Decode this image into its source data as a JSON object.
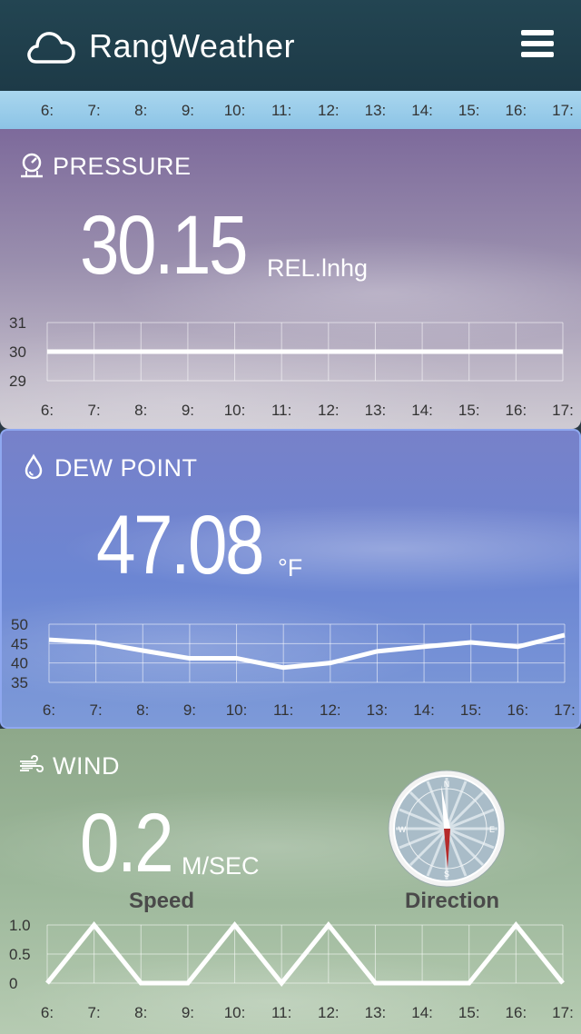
{
  "app": {
    "title": "RangWeather"
  },
  "hours": [
    "6:",
    "7:",
    "8:",
    "9:",
    "10:",
    "11:",
    "12:",
    "13:",
    "14:",
    "15:",
    "16:",
    "17:"
  ],
  "pressure": {
    "title": "PRESSURE",
    "value": "30.15",
    "unit": "REL.lnhg",
    "icon": "pressure-gauge-icon",
    "chart_data": {
      "type": "line",
      "categories": [
        "6:",
        "7:",
        "8:",
        "9:",
        "10:",
        "11:",
        "12:",
        "13:",
        "14:",
        "15:",
        "16:",
        "17:"
      ],
      "series": [
        {
          "values": [
            30,
            30,
            30,
            30,
            30,
            30,
            30,
            30,
            30,
            30,
            30,
            30
          ]
        }
      ],
      "yticks": [
        "31",
        "30",
        "29"
      ],
      "ylim": [
        29,
        31
      ],
      "grid": true
    }
  },
  "dew": {
    "title": "DEW POINT",
    "value": "47.08",
    "unit": "°F",
    "icon": "droplet-icon",
    "chart_data": {
      "type": "line",
      "categories": [
        "6:",
        "7:",
        "8:",
        "9:",
        "10:",
        "11:",
        "12:",
        "13:",
        "14:",
        "15:",
        "16:",
        "17:"
      ],
      "series": [
        {
          "values": [
            46,
            45.3,
            43.2,
            41.2,
            41.2,
            38.8,
            40,
            43,
            44.2,
            45.3,
            44.2,
            47.2
          ]
        }
      ],
      "yticks": [
        "50",
        "45",
        "40",
        "35"
      ],
      "ylim": [
        35,
        50
      ],
      "grid": true
    }
  },
  "wind": {
    "title": "WIND",
    "value": "0.2",
    "unit": "M/SEC",
    "speed_label": "Speed",
    "direction_label": "Direction",
    "icon": "wind-icon",
    "compass": {
      "n": "N",
      "s": "S",
      "e": "E",
      "w": "W"
    },
    "chart_data": {
      "type": "line",
      "categories": [
        "6:",
        "7:",
        "8:",
        "9:",
        "10:",
        "11:",
        "12:",
        "13:",
        "14:",
        "15:",
        "16:",
        "17:"
      ],
      "series": [
        {
          "values": [
            0,
            1,
            0,
            0,
            1,
            0,
            1,
            0,
            0,
            0,
            1,
            0
          ]
        }
      ],
      "yticks": [
        "1.0",
        "0.5",
        "0"
      ],
      "ylim": [
        0,
        1
      ],
      "grid": true
    }
  }
}
